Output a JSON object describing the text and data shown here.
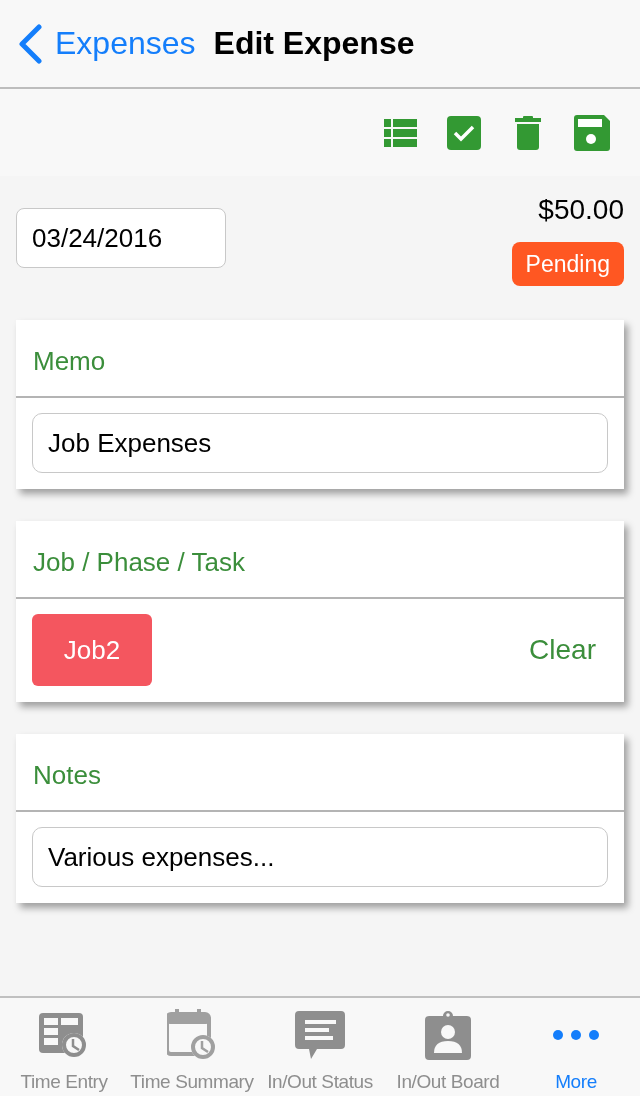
{
  "nav": {
    "back_label": "Expenses",
    "title": "Edit Expense"
  },
  "expense": {
    "date": "03/24/2016",
    "amount": "$50.00",
    "status": "Pending"
  },
  "sections": [
    {
      "kind": "input",
      "title": "Memo",
      "value": "Job Expenses"
    },
    {
      "kind": "selection",
      "title": "Job / Phase / Task",
      "chip": "Job2",
      "action": "Clear"
    },
    {
      "kind": "input",
      "title": "Notes",
      "value": "Various expenses..."
    }
  ],
  "tab_bar": {
    "tabs": [
      {
        "label": "Time Entry",
        "selected": false
      },
      {
        "label": "Time Summary",
        "selected": false
      },
      {
        "label": "In/Out Status",
        "selected": false
      },
      {
        "label": "In/Out Board",
        "selected": false
      },
      {
        "label": "More",
        "selected": true
      }
    ]
  }
}
